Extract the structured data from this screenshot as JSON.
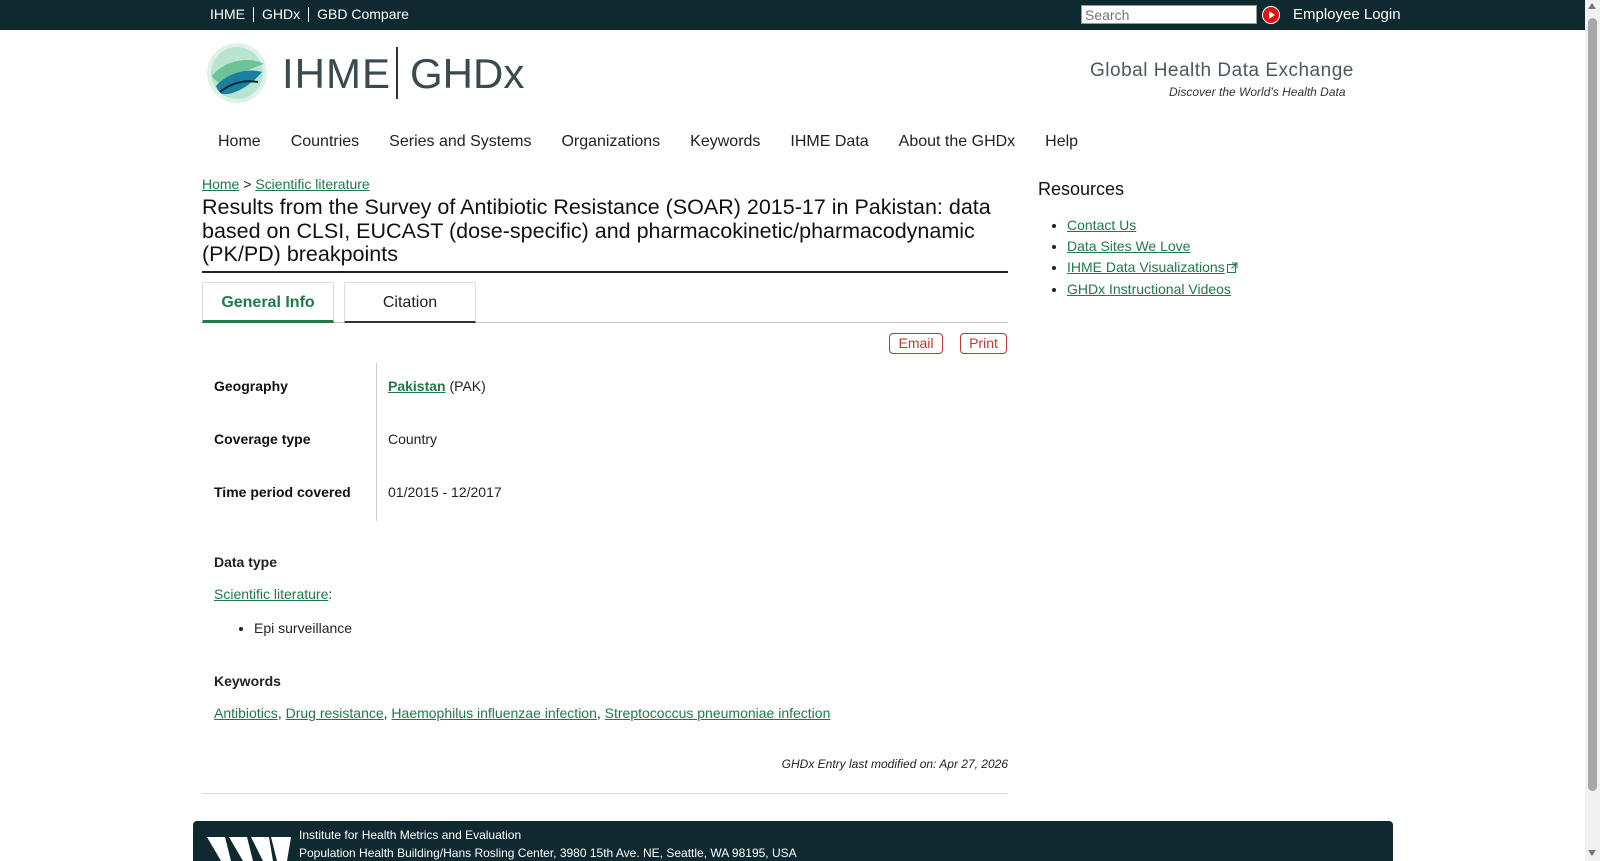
{
  "topbar": {
    "links": [
      "IHME",
      "GHDx",
      "GBD Compare"
    ],
    "search_placeholder": "Search",
    "login": "Employee Login"
  },
  "header": {
    "logo_ihme": "IHME",
    "logo_ghdx": "GHDx",
    "tagline": "Global Health Data Exchange",
    "subtagline": "Discover the World’s Health Data"
  },
  "nav": [
    "Home",
    "Countries",
    "Series and Systems",
    "Organizations",
    "Keywords",
    "IHME Data",
    "About the GHDx",
    "Help"
  ],
  "breadcrumb": {
    "home": "Home",
    "sep": " > ",
    "current": "Scientific literature"
  },
  "title": "Results from the Survey of Antibiotic Resistance (SOAR) 2015-17 in Pakistan: data based on CLSI, EUCAST (dose-specific) and pharmacokinetic/pharmacodynamic (PK/PD) breakpoints",
  "tabs": {
    "general": "General Info",
    "citation": "Citation"
  },
  "actions": {
    "email": "Email",
    "print": "Print"
  },
  "info": {
    "geography_label": "Geography",
    "geography_link": "Pakistan",
    "geography_code": " (PAK)",
    "coverage_label": "Coverage type",
    "coverage_value": "Country",
    "time_label": "Time period covered",
    "time_value": "01/2015 - 12/2017"
  },
  "data_type": {
    "label": "Data type",
    "link": "Scientific literature",
    "colon": ":",
    "items": [
      "Epi surveillance"
    ]
  },
  "keywords": {
    "label": "Keywords",
    "items": [
      "Antibiotics",
      "Drug resistance",
      "Haemophilus influenzae infection",
      "Streptococcus pneumoniae infection"
    ]
  },
  "modified": "GHDx Entry last modified on: Apr 27, 2026",
  "resources": {
    "title": "Resources",
    "items": [
      "Contact Us",
      "Data Sites We Love",
      "IHME Data Visualizations",
      "GHDx Instructional Videos"
    ]
  },
  "footer": {
    "line1": "Institute for Health Metrics and Evaluation",
    "line2": "Population Health Building/Hans Rosling Center, 3980 15th Ave. NE, Seattle, WA 98195, USA"
  },
  "colors": {
    "topbar": "#0e2a30",
    "link": "#1f7a4a",
    "action_red": "#c0392b"
  }
}
